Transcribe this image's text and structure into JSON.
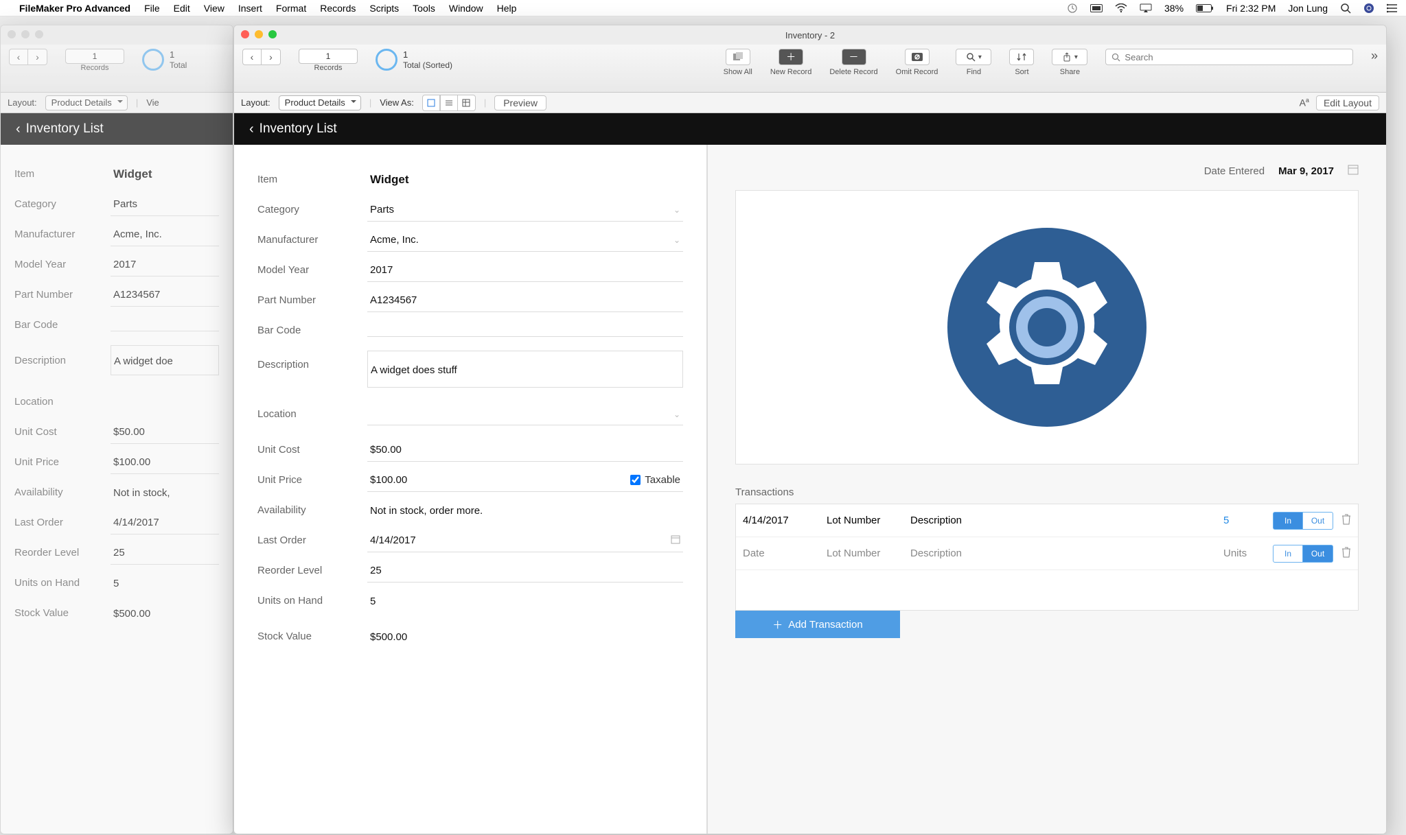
{
  "menubar": {
    "app": "FileMaker Pro Advanced",
    "items": [
      "File",
      "Edit",
      "View",
      "Insert",
      "Format",
      "Records",
      "Scripts",
      "Tools",
      "Window",
      "Help"
    ],
    "battery": "38%",
    "clock": "Fri 2:32 PM",
    "user": "Jon Lung"
  },
  "window_back": {
    "record_number": "1",
    "count": "1",
    "count_label": "Total",
    "records_label": "Records",
    "layout_label": "Layout:",
    "layout_value": "Product Details",
    "viewas_label": "Vie",
    "blackbar": "Inventory List",
    "fields": {
      "item_lbl": "Item",
      "item": "Widget",
      "category_lbl": "Category",
      "category": "Parts",
      "manufacturer_lbl": "Manufacturer",
      "manufacturer": "Acme, Inc.",
      "modelyear_lbl": "Model Year",
      "modelyear": "2017",
      "partnumber_lbl": "Part Number",
      "partnumber": "A1234567",
      "barcode_lbl": "Bar Code",
      "barcode": "",
      "description_lbl": "Description",
      "description": "A widget doe",
      "location_lbl": "Location",
      "location": "",
      "unitcost_lbl": "Unit Cost",
      "unitcost": "$50.00",
      "unitprice_lbl": "Unit Price",
      "unitprice": "$100.00",
      "availability_lbl": "Availability",
      "availability": "Not in stock,",
      "lastorder_lbl": "Last Order",
      "lastorder": "4/14/2017",
      "reorder_lbl": "Reorder Level",
      "reorder": "25",
      "unitsonhand_lbl": "Units on Hand",
      "unitsonhand": "5",
      "stockvalue_lbl": "Stock Value",
      "stockvalue": "$500.00"
    }
  },
  "window_front": {
    "title": "Inventory - 2",
    "record_number": "1",
    "count": "1",
    "count_label": "Total (Sorted)",
    "records_label": "Records",
    "toolbar": {
      "showall": "Show All",
      "newrecord": "New Record",
      "deleterecord": "Delete Record",
      "omitrecord": "Omit Record",
      "find": "Find",
      "sort": "Sort",
      "share": "Share",
      "search_placeholder": "Search"
    },
    "layoutbar": {
      "layout_label": "Layout:",
      "layout_value": "Product Details",
      "viewas_label": "View As:",
      "preview": "Preview",
      "editlayout": "Edit Layout"
    },
    "blackbar": "Inventory List",
    "form": {
      "item_lbl": "Item",
      "item": "Widget",
      "category_lbl": "Category",
      "category": "Parts",
      "manufacturer_lbl": "Manufacturer",
      "manufacturer": "Acme, Inc.",
      "modelyear_lbl": "Model Year",
      "modelyear": "2017",
      "partnumber_lbl": "Part Number",
      "partnumber": "A1234567",
      "barcode_lbl": "Bar Code",
      "barcode": "",
      "description_lbl": "Description",
      "description": "A widget does stuff",
      "location_lbl": "Location",
      "location": "",
      "unitcost_lbl": "Unit Cost",
      "unitcost": "$50.00",
      "unitprice_lbl": "Unit Price",
      "unitprice": "$100.00",
      "taxable_lbl": "Taxable",
      "availability_lbl": "Availability",
      "availability": "Not in stock, order more.",
      "lastorder_lbl": "Last Order",
      "lastorder": "4/14/2017",
      "reorder_lbl": "Reorder Level",
      "reorder": "25",
      "unitsonhand_lbl": "Units on Hand",
      "unitsonhand": "5",
      "stockvalue_lbl": "Stock Value",
      "stockvalue": "$500.00"
    },
    "right": {
      "date_entered_lbl": "Date Entered",
      "date_entered": "Mar 9, 2017",
      "transactions_lbl": "Transactions",
      "row1": {
        "date": "4/14/2017",
        "lot": "Lot Number",
        "desc": "Description",
        "units": "5",
        "in": "In",
        "out": "Out"
      },
      "row2": {
        "date": "Date",
        "lot": "Lot Number",
        "desc": "Description",
        "units": "Units",
        "in": "In",
        "out": "Out"
      },
      "add_transaction": "Add Transaction"
    }
  }
}
